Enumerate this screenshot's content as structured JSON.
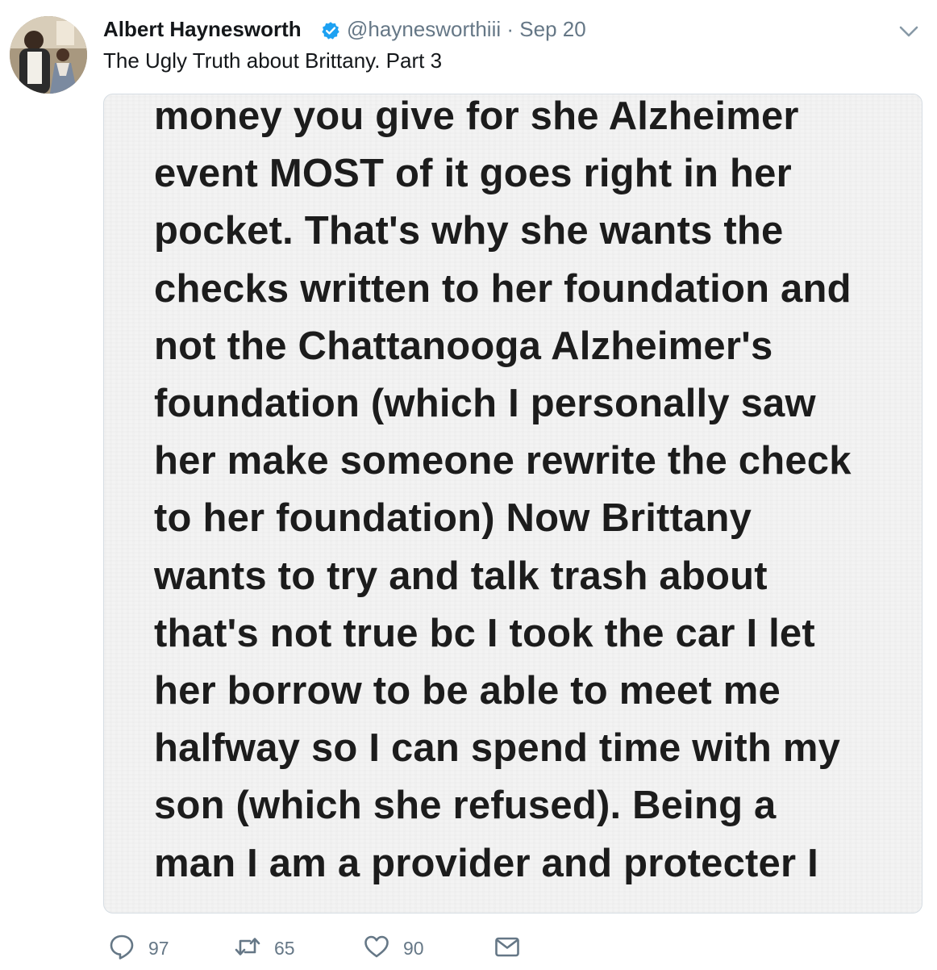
{
  "tweet": {
    "author_name": "Albert Haynesworth",
    "handle": "@haynesworthiii",
    "separator": "·",
    "date": "Sep 20",
    "text": "The Ugly Truth about Brittany. Part 3",
    "verified": true,
    "icons": {
      "verified": "verified-badge-icon",
      "menu": "chevron-down-icon"
    }
  },
  "media": {
    "image_text": "money you give for she Alzheimer\nevent MOST of it goes right in her\npocket. That's why she wants the\nchecks written to her foundation and\nnot the Chattanooga Alzheimer's\nfoundation (which I personally saw\nher make someone rewrite the check\nto her foundation) Now Brittany\nwants to try and talk trash about\nthat's not true bc I took the car I let\nher borrow to be able to meet me\nhalfway so I can spend time with my\nson (which she refused). Being a\nman I am a provider and protecter I"
  },
  "actions": {
    "reply": {
      "icon": "reply-icon",
      "count": "97"
    },
    "retweet": {
      "icon": "retweet-icon",
      "count": "65"
    },
    "like": {
      "icon": "heart-icon",
      "count": "90"
    },
    "dm": {
      "icon": "envelope-icon"
    }
  },
  "colors": {
    "verified_blue": "#1da1f2",
    "meta_gray": "#657786",
    "text_dark": "#14171a"
  }
}
